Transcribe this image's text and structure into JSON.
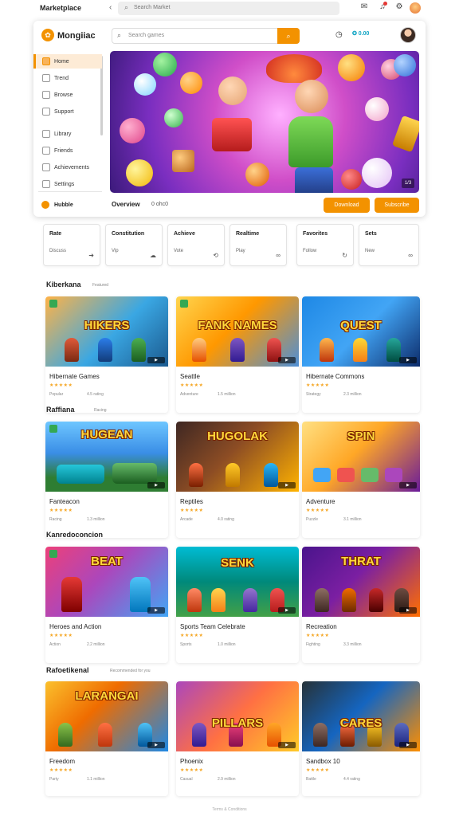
{
  "browser": {
    "title": "Marketplace",
    "back_icon": "chevron-left-icon",
    "url": "Search Market",
    "icons": [
      "mail-icon",
      "bell-icon",
      "settings-icon",
      "avatar"
    ]
  },
  "app": {
    "logo": "Mongiiac",
    "search_placeholder": "Search games",
    "coins": "✪ 0.00",
    "sidebar": [
      {
        "label": "Home",
        "active": true
      },
      {
        "label": "Trend"
      },
      {
        "label": "Browse"
      },
      {
        "label": "Support"
      },
      {
        "label": "Library"
      },
      {
        "label": "Friends"
      },
      {
        "label": "Achievements"
      },
      {
        "label": "Settings"
      }
    ],
    "sidebar_bottom": "Hubble",
    "banner_badge": "1/3",
    "featured_label": "Overview",
    "featured_value": "0 ohc0",
    "buttons": [
      "Download",
      "Subscribe"
    ]
  },
  "categories": [
    {
      "title": "Rate",
      "sub": "Discuss",
      "icon": "arrow-icon"
    },
    {
      "title": "Constitution",
      "sub": "Vip",
      "icon": "cloud-icon"
    },
    {
      "title": "Achieve",
      "sub": "Vote",
      "icon": "sync-icon"
    },
    {
      "title": "Realtime",
      "sub": "Play",
      "icon": "link-icon"
    },
    {
      "title": "Favorites",
      "sub": "Follow",
      "icon": "refresh-icon"
    },
    {
      "title": "Sets",
      "sub": "New",
      "icon": "link-icon"
    }
  ],
  "sections": [
    {
      "title": "Kiberkana",
      "sub": "Featured",
      "games": [
        {
          "thumb": "HIKERS",
          "title": "Hibernate Games",
          "stars": "★★★★★",
          "meta": "Popular",
          "meta2": "4.5 rating"
        },
        {
          "thumb": "FANK NAMES",
          "title": "Seattle",
          "stars": "★★★★★",
          "meta": "Adventure",
          "meta2": "1.5 million"
        },
        {
          "thumb": "QUEST",
          "title": "Hibernate Commons",
          "stars": "★★★★★",
          "meta": "Strategy",
          "meta2": "2.3 million"
        }
      ]
    },
    {
      "title": "Raffiana",
      "sub": "Racing",
      "games": [
        {
          "thumb": "HUGEAN",
          "title": "Fanteacon",
          "stars": "★★★★★",
          "meta": "Racing",
          "meta2": "1.3 million"
        },
        {
          "thumb": "HUGOLAK",
          "title": "Reptiles",
          "stars": "★★★★★",
          "meta": "Arcade",
          "meta2": "4.0 rating"
        },
        {
          "thumb": "SPIN",
          "title": "Adventure",
          "stars": "★★★★★",
          "meta": "Puzzle",
          "meta2": "3.1 million"
        }
      ]
    },
    {
      "title": "Kanredoconcion",
      "sub": "",
      "games": [
        {
          "thumb": "BEAT",
          "title": "Heroes and Action",
          "stars": "★★★★★",
          "meta": "Action",
          "meta2": "2.2 million"
        },
        {
          "thumb": "SENK",
          "title": "Sports Team Celebrate",
          "stars": "★★★★★",
          "meta": "Sports",
          "meta2": "1.0 million"
        },
        {
          "thumb": "THRAT",
          "title": "Recreation",
          "stars": "★★★★★",
          "meta": "Fighting",
          "meta2": "3.3 million"
        }
      ]
    },
    {
      "title": "Rafoetikenal",
      "sub": "Recommended for you",
      "games": [
        {
          "thumb": "LARANGAI",
          "title": "Freedom",
          "stars": "★★★★★",
          "meta": "Party",
          "meta2": "1.1 million"
        },
        {
          "thumb": "PILLARS",
          "title": "Phoenix",
          "stars": "★★★★★",
          "meta": "Casual",
          "meta2": "2.9 million"
        },
        {
          "thumb": "CARES",
          "title": "Sandbox 10",
          "stars": "★★★★★",
          "meta": "Battle",
          "meta2": "4.4 rating"
        }
      ]
    }
  ],
  "footer": "Terms & Conditions",
  "colors": {
    "accent": "#f39200",
    "link": "#12a5c4",
    "star": "#f5a623"
  }
}
